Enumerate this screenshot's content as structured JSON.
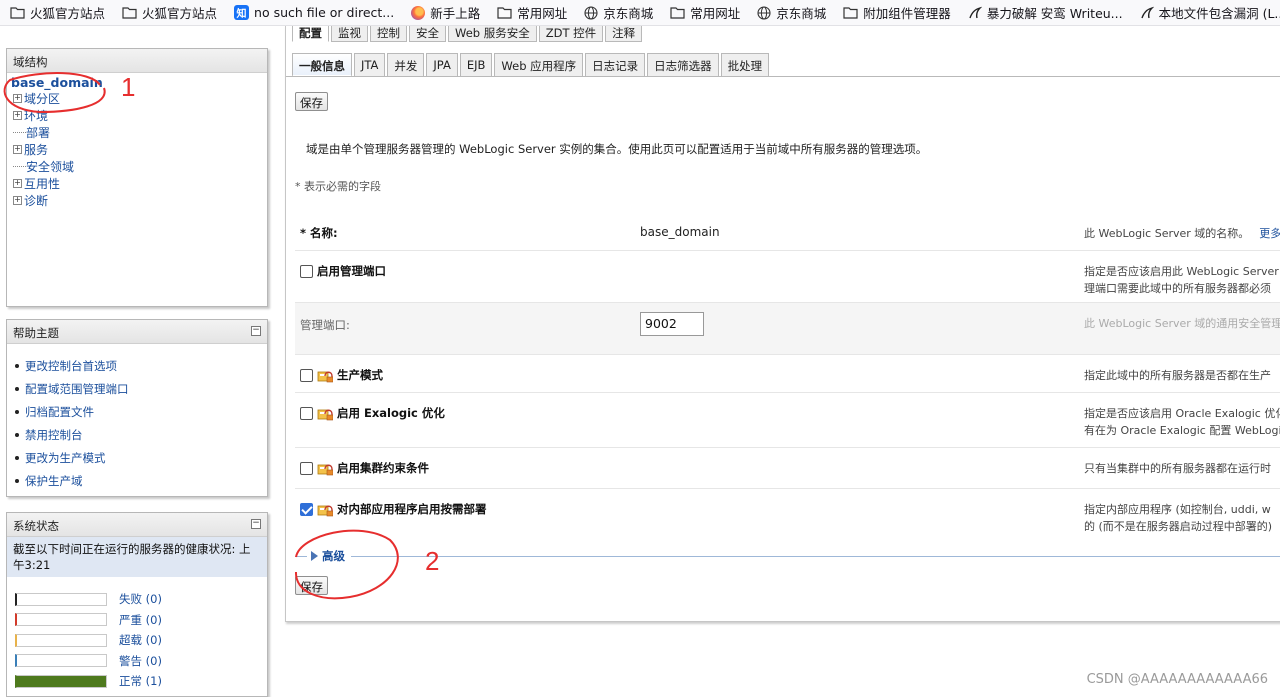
{
  "bookmarks": [
    {
      "icon": "folder-icon",
      "label": "火狐官方站点"
    },
    {
      "icon": "folder-icon",
      "label": "火狐官方站点"
    },
    {
      "icon": "zhihu-icon",
      "label": "no such file or direct..."
    },
    {
      "icon": "firefox-icon",
      "label": "新手上路"
    },
    {
      "icon": "folder-icon",
      "label": "常用网址"
    },
    {
      "icon": "globe-icon",
      "label": "京东商城"
    },
    {
      "icon": "folder-icon",
      "label": "常用网址"
    },
    {
      "icon": "globe-icon",
      "label": "京东商城"
    },
    {
      "icon": "folder-icon",
      "label": "附加组件管理器"
    },
    {
      "icon": "kali-icon",
      "label": "暴力破解 安鸾 Writeu..."
    },
    {
      "icon": "kali-icon",
      "label": "本地文件包含漏洞 (L..."
    }
  ],
  "domain_panel": {
    "title": "域结构",
    "root": "base_domain",
    "items": [
      {
        "label": "域分区",
        "expandable": true
      },
      {
        "label": "环境",
        "expandable": true
      },
      {
        "label": "部署",
        "expandable": false
      },
      {
        "label": "服务",
        "expandable": true
      },
      {
        "label": "安全领域",
        "expandable": false
      },
      {
        "label": "互用性",
        "expandable": true
      },
      {
        "label": "诊断",
        "expandable": true
      }
    ]
  },
  "help_panel": {
    "title": "帮助主题",
    "items": [
      "更改控制台首选项",
      "配置域范围管理端口",
      "归档配置文件",
      "禁用控制台",
      "更改为生产模式",
      "保护生产域"
    ]
  },
  "status_panel": {
    "title": "系统状态",
    "message": "截至以下时间正在运行的服务器的健康状况: 上午3:21",
    "rows": [
      {
        "label": "失败 (0)",
        "color": "#222222",
        "fill": 0
      },
      {
        "label": "严重 (0)",
        "color": "#d23a2a",
        "fill": 0
      },
      {
        "label": "超载 (0)",
        "color": "#e8b24a",
        "fill": 0
      },
      {
        "label": "警告 (0)",
        "color": "#3a7fb8",
        "fill": 0
      },
      {
        "label": "正常 (1)",
        "color": "#4e7a1d",
        "fill": 1
      }
    ]
  },
  "tabs_top": [
    "配置",
    "监视",
    "控制",
    "安全",
    "Web 服务安全",
    "ZDT 控件",
    "注释"
  ],
  "tabs_sub": [
    "一般信息",
    "JTA",
    "并发",
    "JPA",
    "EJB",
    "Web 应用程序",
    "日志记录",
    "日志筛选器",
    "批处理"
  ],
  "save_label": "保存",
  "description": "域是由单个管理服务器管理的 WebLogic Server 实例的集合。使用此页可以配置适用于当前域中所有服务器的管理选项。",
  "required_note": "* 表示必需的字段",
  "form": {
    "name": {
      "label": "* 名称:",
      "value": "base_domain",
      "hint": "此 WebLogic Server 域的名称。",
      "more": "更多"
    },
    "admin_port_enabled": {
      "label": "启用管理端口",
      "hint1": "指定是否应该启用此 WebLogic Server",
      "hint2": "理端口需要此域中的所有服务器都必须"
    },
    "admin_port": {
      "label": "管理端口:",
      "value": "9002",
      "hint": "此 WebLogic Server 域的通用安全管理"
    },
    "production_mode": {
      "label": "生产模式",
      "hint": "指定此域中的所有服务器是否都在生产"
    },
    "exalogic": {
      "label": "启用 Exalogic 优化",
      "hint1": "指定是否应该启用 Oracle Exalogic 优化",
      "hint2": "有在为 Oracle Exalogic 配置 WebLogic"
    },
    "cluster_constraints": {
      "label": "启用集群约束条件",
      "hint": "只有当集群中的所有服务器都在运行时"
    },
    "on_demand_deploy": {
      "label": "对内部应用程序启用按需部署",
      "hint1": "指定内部应用程序 (如控制台, uddi, w",
      "hint2": "的 (而不是在服务器启动过程中部署的)",
      "checked": true
    }
  },
  "advanced_label": "高级",
  "annotations": [
    "1",
    "2"
  ],
  "watermark": "CSDN @AAAAAAAAAAAA66"
}
